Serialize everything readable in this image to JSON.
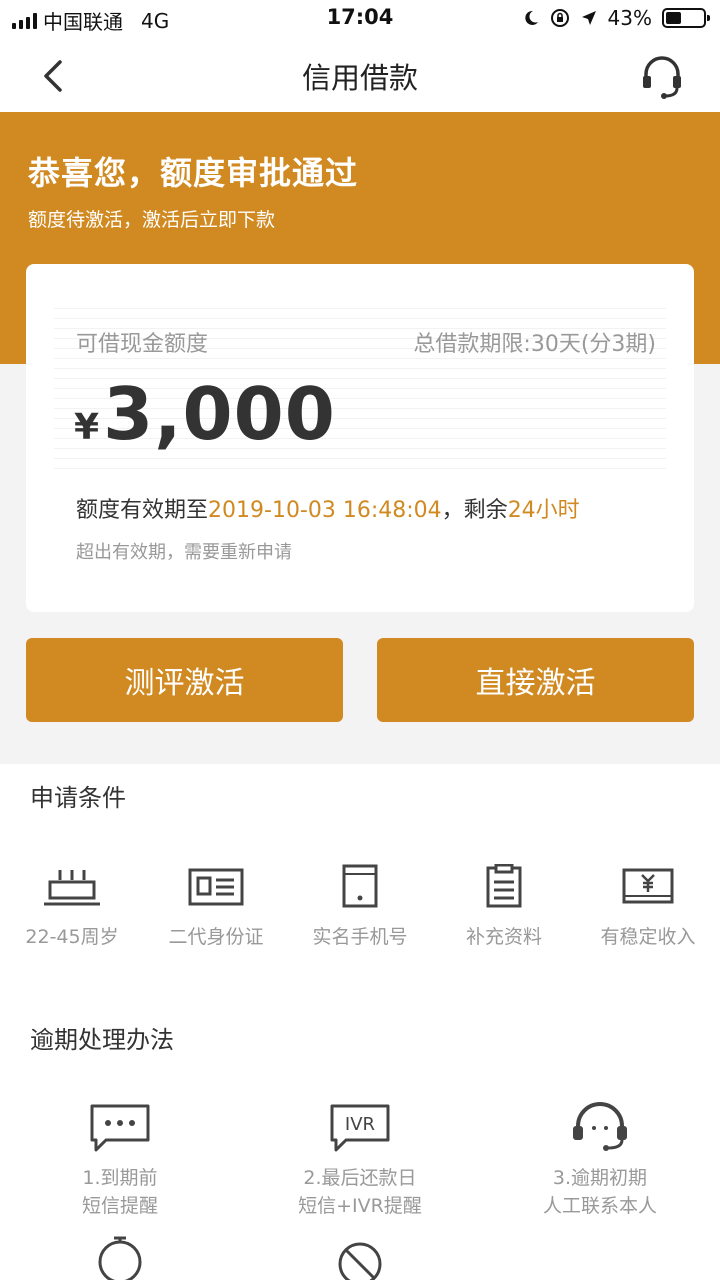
{
  "status_bar": {
    "carrier": "中国联通",
    "network": "4G",
    "time": "17:04",
    "battery_percent": "43%",
    "battery_level": 0.43
  },
  "nav": {
    "title": "信用借款",
    "back_icon": "chevron-left-icon",
    "support_icon": "headset-icon"
  },
  "banner": {
    "title": "恭喜您，额度审批通过",
    "subtitle": "额度待激活，激活后立即下款",
    "color": "#d08a21"
  },
  "card": {
    "amount_label": "可借现金额度",
    "term_label": "总借款期限:30天(分3期)",
    "currency_symbol": "¥",
    "amount": "3,000",
    "validity_prefix": "额度有效期至",
    "validity_date": "2019-10-03 16:48:04",
    "validity_mid": "，剩余",
    "remaining": "24小时",
    "expire_note": "超出有效期，需要重新申请"
  },
  "buttons": {
    "evaluate_activate": "测评激活",
    "direct_activate": "直接激活"
  },
  "conditions": {
    "title": "申请条件",
    "items": [
      {
        "icon": "birthday-cake-icon",
        "label": "22-45周岁"
      },
      {
        "icon": "id-card-icon",
        "label": "二代身份证"
      },
      {
        "icon": "mobile-phone-icon",
        "label": "实名手机号"
      },
      {
        "icon": "clipboard-icon",
        "label": "补充资料"
      },
      {
        "icon": "income-icon",
        "label": "有稳定收入"
      }
    ]
  },
  "overdue": {
    "title": "逾期处理办法",
    "items": [
      {
        "icon": "sms-icon",
        "line1": "1.到期前",
        "line2": "短信提醒"
      },
      {
        "icon": "ivr-icon",
        "line1": "2.最后还款日",
        "line2": "短信+IVR提醒"
      },
      {
        "icon": "headset-icon",
        "line1": "3.逾期初期",
        "line2": "人工联系本人"
      }
    ]
  }
}
